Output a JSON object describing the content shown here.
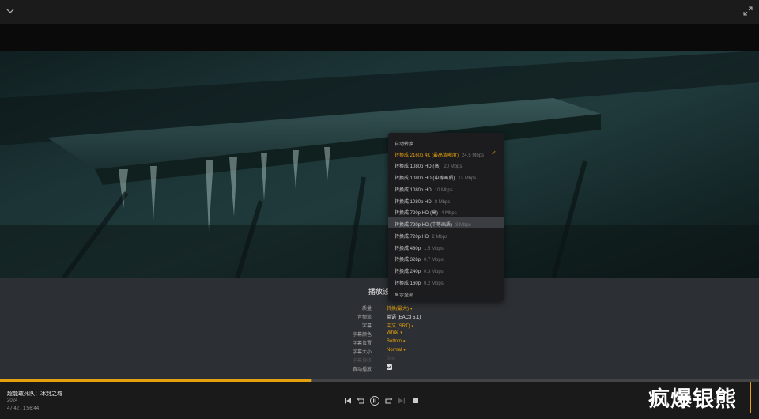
{
  "colors": {
    "accent": "#e5a00d",
    "panel_bg": "#2c2f33",
    "menu_bg": "#1c1c1e"
  },
  "topbar": {
    "collapse_icon": "chevron-down-icon",
    "fullscreen_icon": "expand-icon"
  },
  "settings": {
    "title": "播放设",
    "rows": [
      {
        "label": "质量",
        "value": "转换(最大)",
        "style": "orange"
      },
      {
        "label": "音频流",
        "value": "英语 (EAC3 5.1)",
        "style": "white"
      },
      {
        "label": "字幕",
        "value": "中文 (SRT)",
        "style": "orange"
      },
      {
        "label": "字幕颜色",
        "value": "White",
        "style": "orange"
      },
      {
        "label": "字幕位置",
        "value": "Bottom",
        "style": "orange"
      },
      {
        "label": "字幕大小",
        "value": "Normal",
        "style": "orange"
      },
      {
        "label": "字幕偏移",
        "value": "0ms",
        "style": "dim"
      },
      {
        "label": "自动播放",
        "value": "",
        "style": "checkbox",
        "checked": true
      }
    ]
  },
  "quality_menu": {
    "header": "自动转换",
    "items": [
      {
        "label": "转换成 2160p 4K (最高清晰度)",
        "rate": "24.5 Mbps",
        "selected": true
      },
      {
        "label": "转换成 1080p HD (高)",
        "rate": "20 Mbps"
      },
      {
        "label": "转换成 1080p HD (中等画质)",
        "rate": "12 Mbps"
      },
      {
        "label": "转换成 1080p HD",
        "rate": "10 Mbps"
      },
      {
        "label": "转换成 1080p HD",
        "rate": "8 Mbps"
      },
      {
        "label": "转换成 720p HD (高)",
        "rate": "4 Mbps"
      },
      {
        "label": "转换成 720p HD (中等画质)",
        "rate": "3 Mbps",
        "highlight": true
      },
      {
        "label": "转换成 720p HD",
        "rate": "2 Mbps"
      },
      {
        "label": "转换成 480p",
        "rate": "1.5 Mbps"
      },
      {
        "label": "转换成 328p",
        "rate": "0.7 Mbps"
      },
      {
        "label": "转换成 240p",
        "rate": "0.3 Mbps"
      },
      {
        "label": "转换成 160p",
        "rate": "0.2 Mbps"
      }
    ],
    "footer": "显示全部",
    "check_icon": "checkmark-icon"
  },
  "playback": {
    "title": "超能敢死队：冰封之城",
    "year": "2024",
    "time": "47:42 / 1:56:44",
    "progress_fraction": 0.409,
    "buffer_fraction": 0.41
  },
  "controls": {
    "icons": [
      "skip-previous-icon",
      "replay-icon",
      "pause-icon",
      "forward-icon",
      "skip-next-icon",
      "stop-icon"
    ]
  },
  "watermark": "疯爆银熊"
}
